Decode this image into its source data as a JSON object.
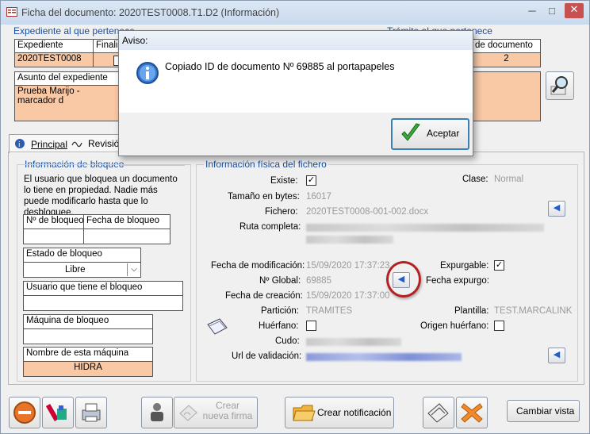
{
  "window": {
    "title": "Ficha del documento: 2020TEST0008.T1.D2 (Información)",
    "minimize": "─",
    "maximize": "□",
    "close": "✕"
  },
  "expediente": {
    "section_label": "Expediente al que pertenece",
    "col_expediente": "Expediente",
    "col_finalizado": "Finaliza",
    "value_expediente": "2020TEST0008",
    "asunto_label": "Asunto del expediente",
    "asunto_value": "Prueba Marijo - marcador d"
  },
  "tramite": {
    "section_label": "Trámite al que pertenece",
    "col_doc": "de documento",
    "value_doc": "2"
  },
  "tabs": [
    {
      "label": "Principal"
    },
    {
      "label": "Revisió"
    }
  ],
  "bloqueo": {
    "section_label": "Información de bloqueo",
    "description": "El usuario que bloquea un documento lo tiene en propiedad. Nadie más puede modificarlo hasta que lo desbloquee.",
    "col_num": "Nº de bloqueo",
    "col_fecha": "Fecha de bloqueo",
    "estado_label": "Estado de bloqueo",
    "estado_value": "Libre",
    "usuario_label": "Usuario que tiene el bloqueo",
    "maquina_label": "Máquina de bloqueo",
    "nombre_label": "Nombre de esta máquina",
    "nombre_value": "HIDRA"
  },
  "fisica": {
    "section_label": "Información física del fichero",
    "existe_label": "Existe:",
    "existe_checked": true,
    "clase_label": "Clase:",
    "clase_value": "Normal",
    "tamano_label": "Tamaño en bytes:",
    "tamano_value": "16017",
    "fichero_label": "Fichero:",
    "fichero_value": "2020TEST0008-001-002.docx",
    "ruta_label": "Ruta completa:",
    "fecha_mod_label": "Fecha de modificación:",
    "fecha_mod_value": "15/09/2020 17:37:23",
    "expurgable_label": "Expurgable:",
    "expurgable_checked": true,
    "nglobal_label": "Nº Global:",
    "nglobal_value": "69885",
    "fecha_expurgo_label": "Fecha expurgo:",
    "fecha_creacion_label": "Fecha de creación:",
    "fecha_creacion_value": "15/09/2020 17:37:00",
    "particion_label": "Partición:",
    "particion_value": "TRAMITES",
    "plantilla_label": "Plantilla:",
    "plantilla_value": "TEST.MARCALINK",
    "huerfano_label": "Huérfano:",
    "origen_label": "Origen huérfano:",
    "cudo_label": "Cudo:",
    "url_label": "Url de validación:"
  },
  "toolbar": {
    "crear_firma": "Crear nueva firma",
    "crear_notificacion": "Crear notificación",
    "cambiar_vista": "Cambiar vista"
  },
  "dialog": {
    "title": "Aviso:",
    "message": "Copiado ID de documento Nº 69885 al portapapeles",
    "ok_label": "Aceptar"
  },
  "colors": {
    "accent": "#1a4fa0",
    "peach": "#f9c9a5",
    "highlight": "#b22222"
  }
}
